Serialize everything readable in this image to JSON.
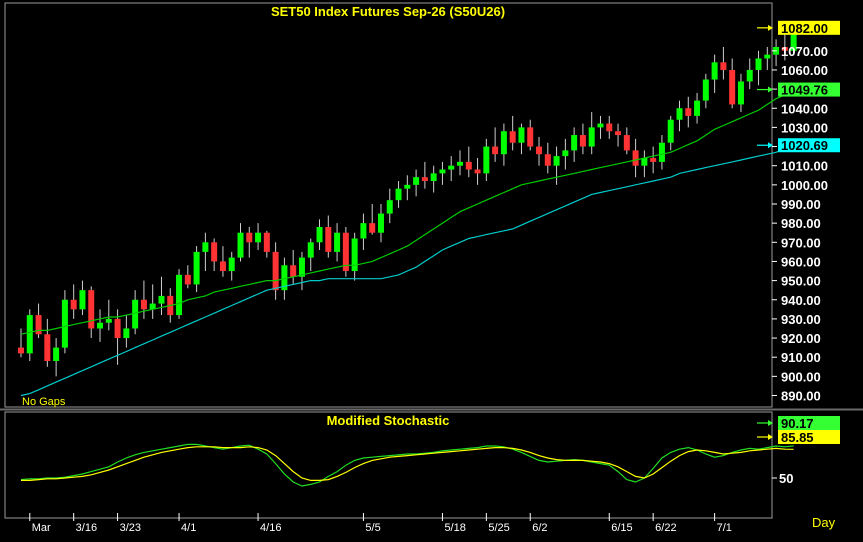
{
  "main_panel": {
    "title": "SET50  Index  Futures  Sep-26  (S50U26)",
    "footnote": "No  Gaps",
    "y_ticks": [
      "1070.00",
      "1060.00",
      "1050.00",
      "1040.00",
      "1030.00",
      "1020.00",
      "1010.00",
      "1000.00",
      "990.00",
      "980.00",
      "970.00",
      "960.00",
      "950.00",
      "940.00",
      "930.00",
      "920.00",
      "910.00",
      "900.00",
      "890.00"
    ],
    "labels": [
      {
        "text": "1082.00",
        "value": 1082.0,
        "color": "#ffff00"
      },
      {
        "text": "1049.76",
        "value": 1049.76,
        "color": "#33ff33"
      },
      {
        "text": "1020.69",
        "value": 1020.69,
        "color": "#00ffff"
      }
    ]
  },
  "stoch_panel": {
    "title": "Modified  Stochastic",
    "y_tick": "50",
    "labels": [
      {
        "text": "90.17",
        "value": 90.17,
        "color": "#33ff33"
      },
      {
        "text": "85.85",
        "value": 85.85,
        "color": "#ffff00"
      }
    ]
  },
  "x_axis": {
    "labels": [
      {
        "text": "Mar",
        "i": 1
      },
      {
        "text": "3/16",
        "i": 6
      },
      {
        "text": "3/23",
        "i": 11
      },
      {
        "text": "4/1",
        "i": 18
      },
      {
        "text": "4/16",
        "i": 27
      },
      {
        "text": "5/5",
        "i": 39
      },
      {
        "text": "5/18",
        "i": 48
      },
      {
        "text": "5/25",
        "i": 53
      },
      {
        "text": "6/2",
        "i": 58
      },
      {
        "text": "6/15",
        "i": 67
      },
      {
        "text": "6/22",
        "i": 72
      },
      {
        "text": "7/1",
        "i": 79
      }
    ],
    "period": "Day"
  },
  "colors": {
    "background": "#000000",
    "up_candle": "#00ff00",
    "down_candle": "#ff3333",
    "ma_short": "#00cc00",
    "ma_long": "#00cccc",
    "stoch_k": "#22dd22",
    "stoch_d": "#ffff00",
    "axis": "#ffffff"
  },
  "chart_data": [
    {
      "type": "candlestick",
      "title": "SET50  Index  Futures  Sep-26  (S50U26)",
      "ylim": [
        884,
        1086
      ],
      "series": [
        {
          "name": "candles",
          "ohlc": [
            [
              915,
              925,
              910,
              912
            ],
            [
              912,
              935,
              908,
              932
            ],
            [
              932,
              938,
              920,
              922
            ],
            [
              922,
              930,
              905,
              908
            ],
            [
              908,
              920,
              900,
              915
            ],
            [
              915,
              945,
              912,
              940
            ],
            [
              940,
              948,
              930,
              935
            ],
            [
              935,
              950,
              932,
              945
            ],
            [
              945,
              947,
              920,
              925
            ],
            [
              925,
              935,
              918,
              928
            ],
            [
              928,
              940,
              924,
              930
            ],
            [
              930,
              935,
              906,
              920
            ],
            [
              920,
              932,
              915,
              925
            ],
            [
              925,
              945,
              922,
              940
            ],
            [
              940,
              950,
              930,
              935
            ],
            [
              935,
              948,
              930,
              938
            ],
            [
              938,
              952,
              932,
              942
            ],
            [
              942,
              946,
              928,
              932
            ],
            [
              932,
              956,
              930,
              953
            ],
            [
              953,
              958,
              946,
              948
            ],
            [
              948,
              968,
              944,
              965
            ],
            [
              965,
              975,
              955,
              970
            ],
            [
              970,
              972,
              955,
              960
            ],
            [
              960,
              968,
              952,
              955
            ],
            [
              955,
              965,
              950,
              962
            ],
            [
              962,
              980,
              960,
              975
            ],
            [
              975,
              978,
              962,
              970
            ],
            [
              970,
              980,
              966,
              975
            ],
            [
              975,
              976,
              962,
              965
            ],
            [
              965,
              970,
              940,
              945
            ],
            [
              945,
              962,
              940,
              958
            ],
            [
              958,
              966,
              948,
              952
            ],
            [
              952,
              965,
              945,
              962
            ],
            [
              962,
              972,
              955,
              970
            ],
            [
              970,
              982,
              966,
              978
            ],
            [
              978,
              984,
              962,
              965
            ],
            [
              965,
              980,
              960,
              975
            ],
            [
              975,
              978,
              952,
              955
            ],
            [
              955,
              975,
              950,
              972
            ],
            [
              972,
              985,
              966,
              980
            ],
            [
              980,
              990,
              974,
              975
            ],
            [
              975,
              990,
              970,
              985
            ],
            [
              985,
              998,
              980,
              992
            ],
            [
              992,
              1002,
              988,
              998
            ],
            [
              998,
              1005,
              992,
              1000
            ],
            [
              1000,
              1008,
              994,
              1004
            ],
            [
              1004,
              1012,
              998,
              1002
            ],
            [
              1002,
              1010,
              996,
              1006
            ],
            [
              1006,
              1012,
              1000,
              1008
            ],
            [
              1008,
              1015,
              1002,
              1010
            ],
            [
              1010,
              1018,
              1005,
              1012
            ],
            [
              1012,
              1020,
              1004,
              1008
            ],
            [
              1008,
              1014,
              1000,
              1006
            ],
            [
              1006,
              1024,
              1002,
              1020
            ],
            [
              1020,
              1030,
              1012,
              1016
            ],
            [
              1016,
              1032,
              1010,
              1028
            ],
            [
              1028,
              1036,
              1018,
              1022
            ],
            [
              1022,
              1032,
              1016,
              1030
            ],
            [
              1030,
              1034,
              1018,
              1020
            ],
            [
              1020,
              1025,
              1010,
              1016
            ],
            [
              1016,
              1022,
              1006,
              1010
            ],
            [
              1010,
              1020,
              1000,
              1015
            ],
            [
              1015,
              1024,
              1008,
              1018
            ],
            [
              1018,
              1030,
              1012,
              1026
            ],
            [
              1026,
              1032,
              1016,
              1020
            ],
            [
              1020,
              1038,
              1016,
              1030
            ],
            [
              1030,
              1036,
              1024,
              1032
            ],
            [
              1032,
              1036,
              1024,
              1028
            ],
            [
              1028,
              1032,
              1020,
              1026
            ],
            [
              1026,
              1030,
              1016,
              1018
            ],
            [
              1018,
              1024,
              1004,
              1010
            ],
            [
              1010,
              1018,
              1004,
              1014
            ],
            [
              1014,
              1020,
              1006,
              1012
            ],
            [
              1012,
              1026,
              1008,
              1022
            ],
            [
              1022,
              1036,
              1018,
              1034
            ],
            [
              1034,
              1044,
              1028,
              1040
            ],
            [
              1040,
              1046,
              1030,
              1036
            ],
            [
              1036,
              1048,
              1032,
              1044
            ],
            [
              1044,
              1058,
              1040,
              1055
            ],
            [
              1055,
              1068,
              1048,
              1064
            ],
            [
              1064,
              1072,
              1055,
              1060
            ],
            [
              1060,
              1066,
              1040,
              1042
            ],
            [
              1042,
              1058,
              1038,
              1054
            ],
            [
              1054,
              1066,
              1050,
              1060
            ],
            [
              1060,
              1070,
              1052,
              1066
            ],
            [
              1066,
              1072,
              1060,
              1068
            ],
            [
              1068,
              1076,
              1062,
              1072
            ],
            [
              1072,
              1080,
              1065,
              1070
            ],
            [
              1070,
              1084,
              1068,
              1082
            ]
          ]
        },
        {
          "name": "ma_short",
          "values": [
            922,
            923,
            924,
            924,
            925,
            926,
            927,
            928,
            929,
            930,
            931,
            931,
            932,
            933,
            934,
            935,
            936,
            937,
            938,
            940,
            941,
            942,
            944,
            945,
            946,
            947,
            948,
            949,
            950,
            950,
            951,
            952,
            953,
            954,
            955,
            956,
            957,
            958,
            958,
            959,
            960,
            962,
            964,
            966,
            968,
            971,
            974,
            977,
            980,
            983,
            986,
            988,
            990,
            992,
            994,
            996,
            998,
            1000,
            1001,
            1002,
            1003,
            1004,
            1005,
            1006,
            1007,
            1008,
            1009,
            1010,
            1011,
            1012,
            1013,
            1014,
            1015,
            1016,
            1017,
            1019,
            1021,
            1023,
            1026,
            1029,
            1031,
            1033,
            1035,
            1037,
            1039,
            1042,
            1045,
            1047,
            1049.76
          ]
        },
        {
          "name": "ma_long",
          "values": [
            890,
            891,
            893,
            895,
            897,
            899,
            901,
            903,
            905,
            907,
            909,
            911,
            913,
            915,
            917,
            919,
            921,
            923,
            925,
            927,
            929,
            931,
            933,
            935,
            937,
            939,
            941,
            943,
            945,
            946,
            947,
            948,
            949,
            950,
            950,
            951,
            951,
            951,
            951,
            951,
            951,
            951,
            952,
            953,
            955,
            957,
            960,
            963,
            966,
            968,
            970,
            972,
            973,
            974,
            975,
            976,
            977,
            979,
            981,
            983,
            985,
            987,
            989,
            991,
            993,
            995,
            996,
            997,
            998,
            999,
            1000,
            1001,
            1002,
            1003,
            1004,
            1006,
            1007,
            1008,
            1009,
            1010,
            1011,
            1012,
            1013,
            1014,
            1015,
            1016,
            1017,
            1019,
            1020.69
          ]
        }
      ]
    },
    {
      "type": "line",
      "title": "Modified  Stochastic",
      "ylim": [
        0,
        100
      ],
      "series": [
        {
          "name": "stoch_k",
          "values": [
            48,
            49,
            49,
            50,
            50,
            51,
            53,
            55,
            58,
            61,
            64,
            70,
            75,
            79,
            82,
            84,
            86,
            88,
            90,
            92,
            92,
            90,
            88,
            86,
            88,
            90,
            91,
            86,
            80,
            68,
            55,
            45,
            40,
            42,
            45,
            52,
            58,
            66,
            72,
            75,
            76,
            77,
            78,
            79,
            80,
            80,
            81,
            82,
            84,
            85,
            86,
            87,
            88,
            90,
            90,
            89,
            86,
            82,
            77,
            72,
            70,
            71,
            72,
            73,
            72,
            70,
            68,
            66,
            58,
            48,
            45,
            50,
            62,
            75,
            82,
            86,
            88,
            85,
            80,
            76,
            78,
            82,
            85,
            87,
            86,
            88,
            90,
            89,
            90.17
          ]
        },
        {
          "name": "stoch_d",
          "values": [
            47,
            47,
            48,
            49,
            49,
            50,
            51,
            52,
            54,
            57,
            60,
            64,
            68,
            72,
            76,
            79,
            82,
            84,
            86,
            88,
            89,
            89,
            89,
            88,
            88,
            88,
            89,
            88,
            85,
            78,
            68,
            58,
            50,
            47,
            47,
            48,
            52,
            57,
            63,
            68,
            72,
            74,
            76,
            77,
            78,
            79,
            80,
            81,
            82,
            83,
            84,
            85,
            86,
            87,
            88,
            88,
            87,
            85,
            82,
            78,
            75,
            73,
            72,
            72,
            72,
            71,
            70,
            68,
            64,
            58,
            52,
            50,
            55,
            63,
            71,
            78,
            83,
            85,
            84,
            82,
            80,
            81,
            82,
            84,
            85,
            86,
            87,
            86,
            85.85
          ]
        }
      ]
    }
  ]
}
